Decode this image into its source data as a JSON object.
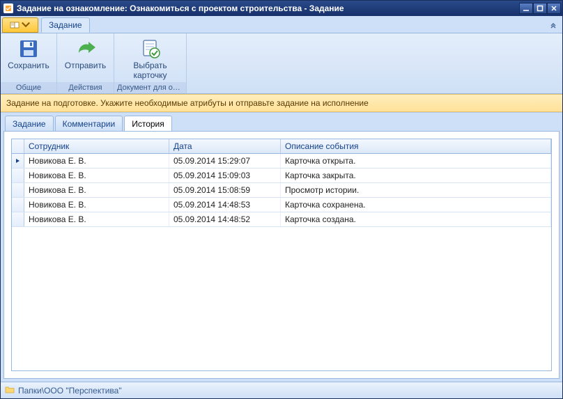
{
  "window": {
    "title": "Задание на ознакомление: Ознакомиться с проектом строительства - Задание"
  },
  "ribbon": {
    "active_tab": "Задание",
    "groups": [
      {
        "label": "Общие",
        "buttons": [
          {
            "name": "save-button",
            "label": "Сохранить",
            "icon": "floppy-icon"
          }
        ]
      },
      {
        "label": "Действия",
        "buttons": [
          {
            "name": "send-button",
            "label": "Отправить",
            "icon": "send-icon"
          }
        ]
      },
      {
        "label": "Документ для озн…",
        "buttons": [
          {
            "name": "choose-card-button",
            "label": "Выбрать\nкарточку",
            "icon": "card-check-icon"
          }
        ]
      }
    ]
  },
  "infobar": "Задание на подготовке. Укажите необходимые атрибуты и отправьте задание на исполнение",
  "tabs": [
    {
      "label": "Задание",
      "active": false
    },
    {
      "label": "Комментарии",
      "active": false
    },
    {
      "label": "История",
      "active": true
    }
  ],
  "grid": {
    "columns": {
      "employee": "Сотрудник",
      "date": "Дата",
      "desc": "Описание события"
    },
    "rows": [
      {
        "employee": "Новикова Е. В.",
        "date": "05.09.2014 15:29:07",
        "desc": "Карточка открыта.",
        "current": true
      },
      {
        "employee": "Новикова Е. В.",
        "date": "05.09.2014 15:09:03",
        "desc": "Карточка закрыта.",
        "current": false
      },
      {
        "employee": "Новикова Е. В.",
        "date": "05.09.2014 15:08:59",
        "desc": "Просмотр истории.",
        "current": false
      },
      {
        "employee": "Новикова Е. В.",
        "date": "05.09.2014 14:48:53",
        "desc": "Карточка сохранена.",
        "current": false
      },
      {
        "employee": "Новикова Е. В.",
        "date": "05.09.2014 14:48:52",
        "desc": "Карточка создана.",
        "current": false
      }
    ]
  },
  "statusbar": {
    "path": "Папки\\ООО \"Перспектива\""
  }
}
